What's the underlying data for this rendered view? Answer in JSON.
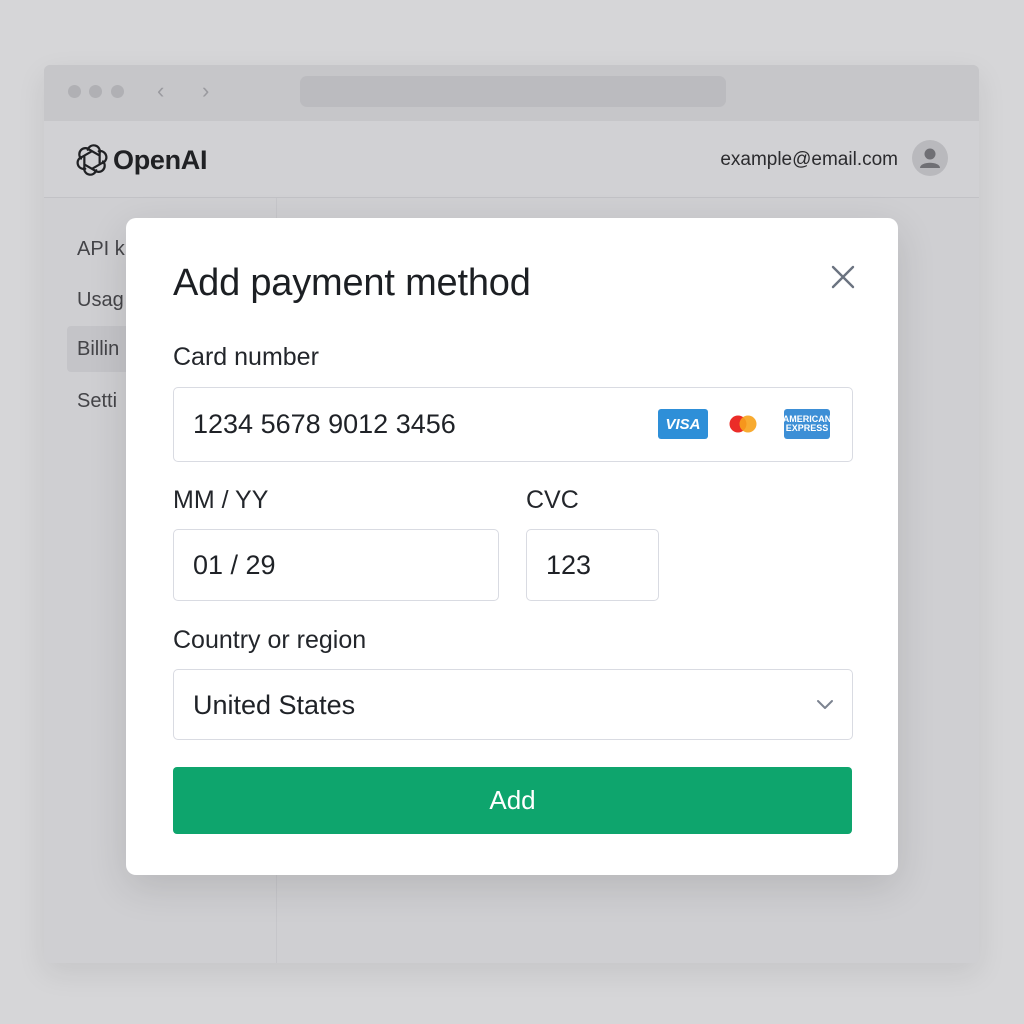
{
  "browser": {
    "back_icon": "‹",
    "forward_icon": "›"
  },
  "header": {
    "logo_text": "OpenAI",
    "user_email": "example@email.com"
  },
  "sidebar": {
    "items": [
      {
        "label": "API k"
      },
      {
        "label": "Usag"
      },
      {
        "label": "Billin"
      },
      {
        "label": "Setti"
      }
    ]
  },
  "modal": {
    "title": "Add payment method",
    "card_number": {
      "label": "Card number",
      "value": "1234 5678 9012 3456",
      "brands": {
        "visa": "VISA",
        "amex_line1": "AMERICAN",
        "amex_line2": "EXPRESS"
      }
    },
    "expiry": {
      "label": "MM / YY",
      "value": "01 / 29"
    },
    "cvc": {
      "label": "CVC",
      "value": "123"
    },
    "country": {
      "label": "Country or region",
      "value": "United States"
    },
    "submit_label": "Add"
  },
  "colors": {
    "accent": "#0ea56d",
    "visa": "#2e8fd8",
    "amex": "#3d8fd6",
    "mastercard_red": "#eb2c28",
    "mastercard_orange": "#f7a21b"
  }
}
